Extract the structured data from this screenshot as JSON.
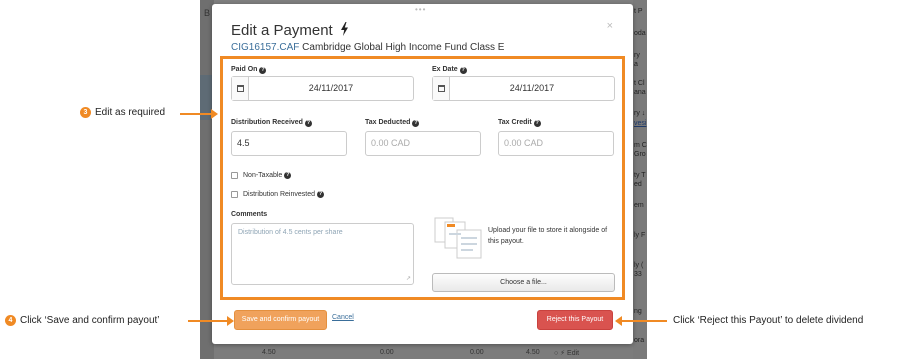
{
  "background": {
    "left_letter": "B",
    "right_fragments": [
      "t P",
      "oda",
      "ry",
      "a",
      "t Cl",
      "ana",
      "ry ↓",
      "vesi",
      "m C",
      "Gro",
      "ty T",
      "ed",
      "em",
      "ly F",
      "ly (",
      "33",
      "ng",
      "ora"
    ],
    "bottom_values": [
      "4.50",
      "0.00",
      "0.00",
      "4.50",
      "○ ⚡ Edit"
    ]
  },
  "modal": {
    "title": "Edit a Payment",
    "code": "CIG16157.CAF",
    "fund_name": "Cambridge Global High Income Fund Class E",
    "close": "×",
    "drag_handle": "•••"
  },
  "form": {
    "paid_on": {
      "label": "Paid On",
      "value": "24/11/2017"
    },
    "ex_date": {
      "label": "Ex Date",
      "value": "24/11/2017"
    },
    "distribution_received": {
      "label": "Distribution Received",
      "value": "4.5"
    },
    "tax_deducted": {
      "label": "Tax Deducted",
      "placeholder": "0.00 CAD"
    },
    "tax_credit": {
      "label": "Tax Credit",
      "placeholder": "0.00 CAD"
    },
    "non_taxable": {
      "label": "Non-Taxable",
      "checked": false
    },
    "distribution_reinvested": {
      "label": "Distribution Reinvested",
      "checked": false
    },
    "comments": {
      "label": "Comments",
      "placeholder": "Distribution of 4.5 cents per share"
    },
    "upload": {
      "text": "Upload your file to store it alongside of this payout.",
      "button": "Choose a file..."
    }
  },
  "actions": {
    "save": "Save and confirm payout",
    "cancel": "Cancel",
    "reject": "Reject this Payout"
  },
  "annotations": {
    "step3": {
      "number": "3",
      "text": "Edit as required"
    },
    "step4": {
      "number": "4",
      "text": "Click ‘Save and confirm payout’"
    },
    "reject_note": "Click ‘Reject this Payout’ to delete dividend"
  },
  "colors": {
    "accent": "#f08a24",
    "save": "#f0a25c",
    "reject": "#d9534f",
    "link": "#3a6e9a"
  }
}
